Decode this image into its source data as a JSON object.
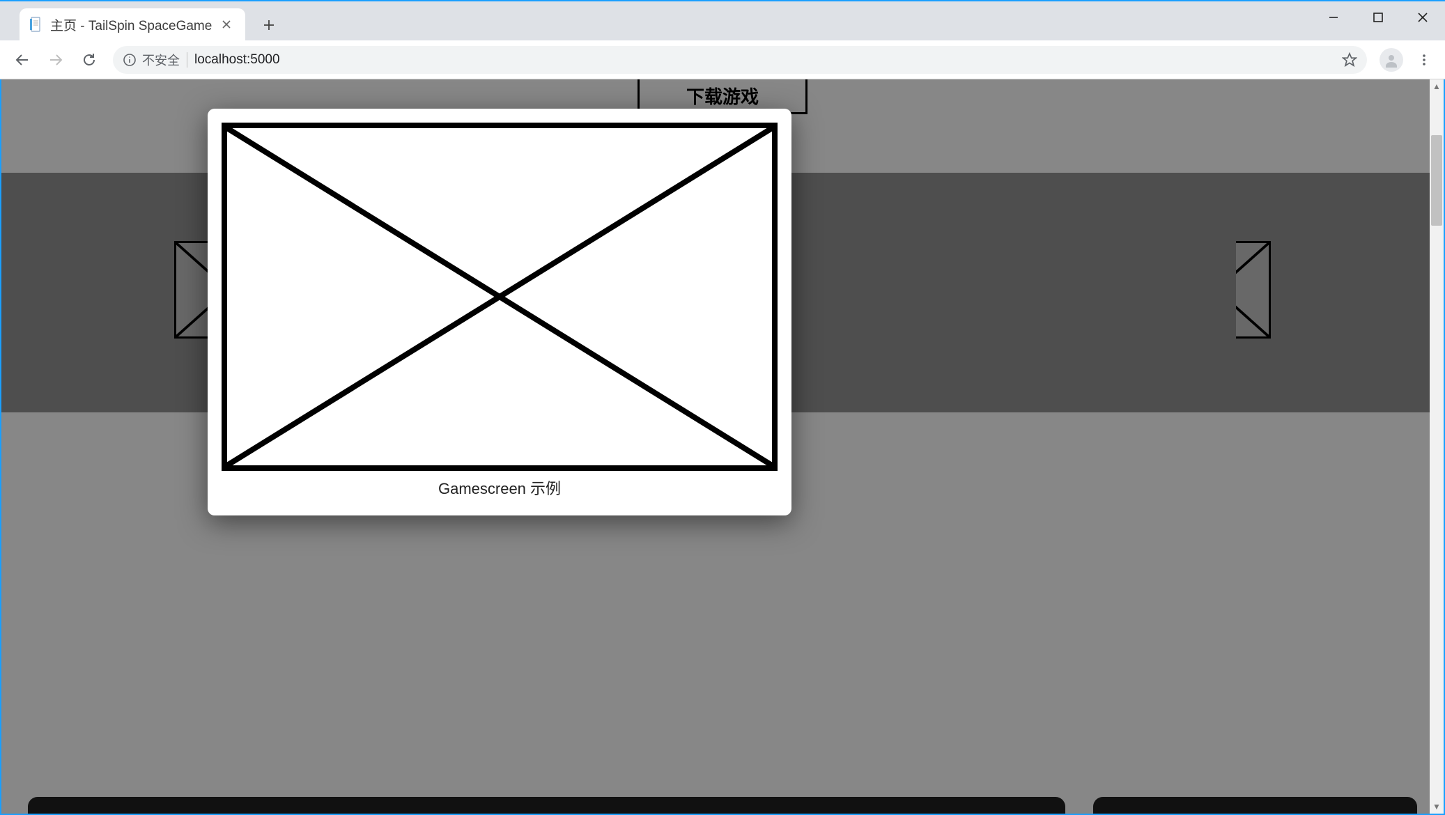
{
  "browser": {
    "tab_title": "主页 - TailSpin SpaceGame",
    "security_label": "不安全",
    "url": "localhost:5000"
  },
  "page": {
    "download_button_label": "下载游戏"
  },
  "modal": {
    "caption": "Gamescreen 示例"
  }
}
